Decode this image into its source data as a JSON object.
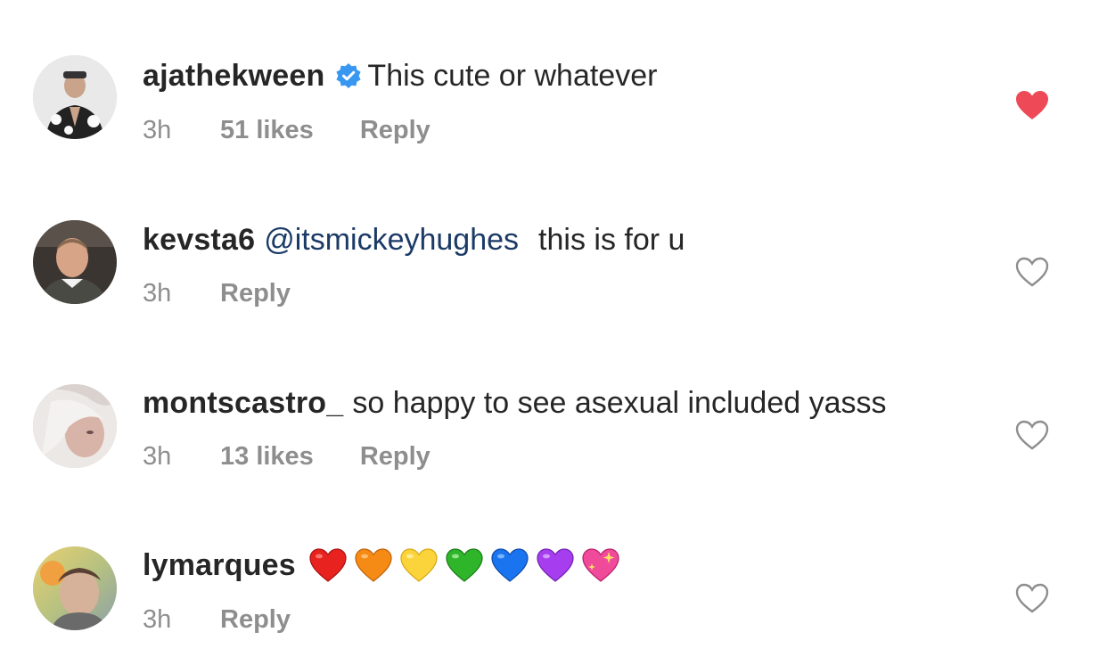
{
  "comments": [
    {
      "username": "ajathekween",
      "verified": true,
      "mention": "",
      "text": "This cute or whatever",
      "time": "3h",
      "likes": "51 likes",
      "reply": "Reply",
      "liked": true
    },
    {
      "username": "kevsta6",
      "verified": false,
      "mention": "@itsmickeyhughes",
      "text": "this is for u",
      "time": "3h",
      "likes": "",
      "reply": "Reply",
      "liked": false
    },
    {
      "username": "montscastro_",
      "verified": false,
      "mention": "",
      "text": "so happy to see asexual included yasss",
      "time": "3h",
      "likes": "13 likes",
      "reply": "Reply",
      "liked": false
    },
    {
      "username": "lymarques",
      "verified": false,
      "mention": "",
      "text": "",
      "emojis": [
        "red-heart",
        "orange-heart",
        "yellow-heart",
        "green-heart",
        "blue-heart",
        "purple-heart",
        "sparkling-heart"
      ],
      "time": "3h",
      "likes": "",
      "reply": "Reply",
      "liked": false
    }
  ],
  "colors": {
    "liked_heart": "#ed4956",
    "mention": "#1b3a66",
    "meta": "#8e8e8e",
    "verified": "#3897f0"
  }
}
